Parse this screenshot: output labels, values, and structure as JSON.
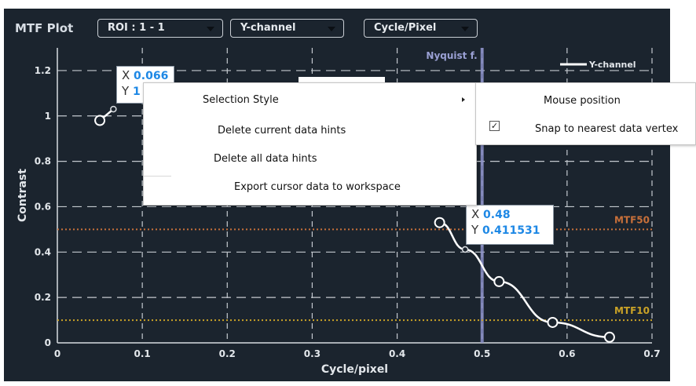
{
  "header": {
    "title": "MTF Plot",
    "roi_dropdown": "ROI : 1 - 1",
    "channel_dropdown": "Y-channel",
    "unit_dropdown": "Cycle/Pixel"
  },
  "chart_data": {
    "type": "line",
    "xlabel": "Cycle/pixel",
    "ylabel": "Contrast",
    "xlim": [
      0,
      0.7
    ],
    "ylim": [
      0,
      1.3
    ],
    "xticks": [
      "0",
      "0.1",
      "0.2",
      "0.3",
      "0.4",
      "0.5",
      "0.6",
      "0.7"
    ],
    "yticks": [
      "0",
      "0.2",
      "0.4",
      "0.6",
      "0.8",
      "1",
      "1.2"
    ],
    "grid": true,
    "legend": {
      "position": "top-right"
    },
    "series": [
      {
        "name": "Y-channel",
        "color": "#ffffff",
        "points": [
          [
            0.05,
            0.98
          ],
          [
            0.066,
            1.03
          ],
          [
            0.45,
            0.53
          ],
          [
            0.48,
            0.411531
          ],
          [
            0.52,
            0.27
          ],
          [
            0.583,
            0.09
          ],
          [
            0.65,
            0.025
          ]
        ],
        "markers": [
          [
            0.05,
            0.98
          ],
          [
            0.45,
            0.53
          ],
          [
            0.52,
            0.27
          ],
          [
            0.583,
            0.09
          ],
          [
            0.65,
            0.025
          ]
        ]
      }
    ],
    "reference_lines": [
      {
        "label": "MTF50",
        "y": 0.5,
        "color": "#c8703a"
      },
      {
        "label": "MTF10",
        "y": 0.1,
        "color": "#c9a227"
      }
    ],
    "nyquist": {
      "label": "Nyquist f.",
      "x": 0.5,
      "color": "#8a90c8"
    },
    "data_hints": [
      {
        "x": "0.066",
        "y": "1"
      },
      {
        "x": "0.48",
        "y": "0.411531"
      }
    ]
  },
  "context_menu": {
    "items": [
      "Selection Style",
      "Delete current data hints",
      "Delete all data hints",
      "Export cursor data to workspace"
    ]
  },
  "submenu": {
    "items": [
      "Mouse position",
      "Snap to nearest data vertex"
    ],
    "checked": "Snap to nearest data vertex"
  }
}
